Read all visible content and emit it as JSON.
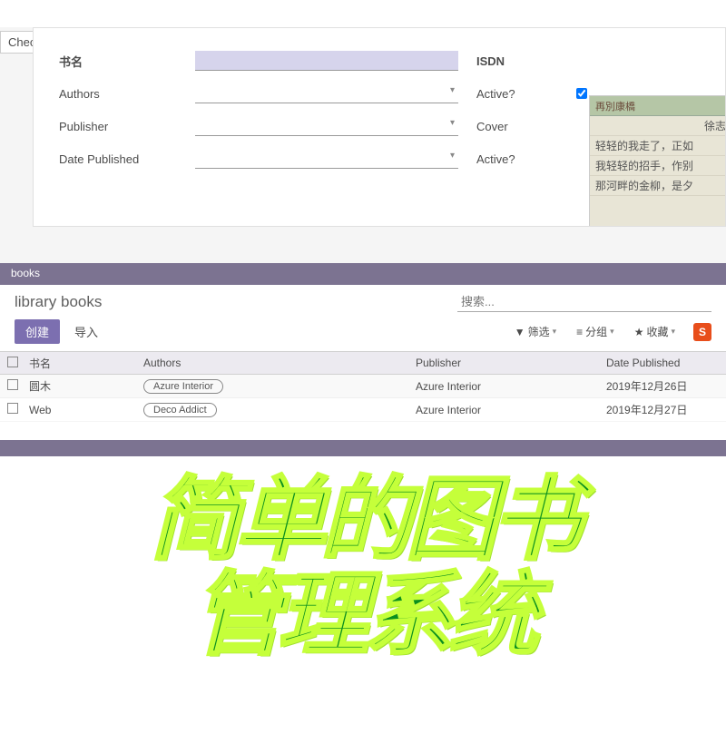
{
  "topForm": {
    "checkIsbn": "Check ISBN",
    "labels": {
      "bookName": "书名",
      "authors": "Authors",
      "publisher": "Publisher",
      "datePublished": "Date Published",
      "isdn": "ISDN",
      "active1": "Active?",
      "cover": "Cover",
      "active2": "Active?"
    },
    "coverLines": [
      "再別康橋",
      "徐志摩",
      "轻轻的我走了，正如",
      "我轻轻的招手，作别",
      "那河畔的金柳，是夕"
    ]
  },
  "midHeader": "books",
  "list": {
    "title": "library books",
    "searchPlaceholder": "搜索...",
    "btnCreate": "创建",
    "btnImport": "导入",
    "filters": {
      "filter": "筛选",
      "group": "分组",
      "favorite": "收藏"
    },
    "imeBadge": "S",
    "columns": {
      "name": "书名",
      "authors": "Authors",
      "publisher": "Publisher",
      "date": "Date Published"
    },
    "rows": [
      {
        "name": "圆木",
        "authorTag": "Azure Interior",
        "publisher": "Azure Interior",
        "date": "2019年12月26日"
      },
      {
        "name": "Web",
        "authorTag": "Deco Addict",
        "publisher": "Azure Interior",
        "date": "2019年12月27日"
      }
    ]
  },
  "hero": {
    "line1": "简单的图书",
    "line2": "管理系统"
  }
}
